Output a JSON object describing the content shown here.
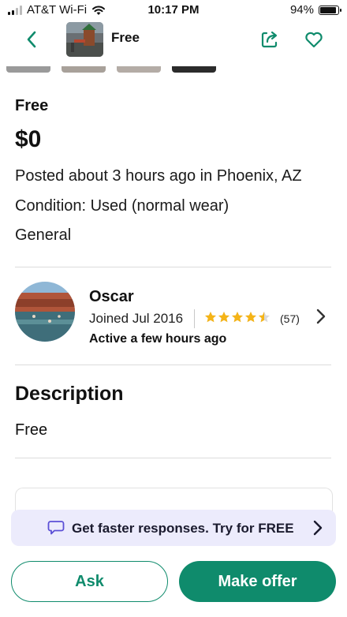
{
  "status_bar": {
    "carrier": "AT&T Wi-Fi",
    "time": "10:17 PM",
    "battery": "94%",
    "battery_level": 0.94
  },
  "header": {
    "title": "Free",
    "back_icon": "chevron-left-icon",
    "share_icon": "share-icon",
    "favorite_icon": "heart-icon"
  },
  "listing": {
    "title": "Free",
    "price": "$0",
    "posted": "Posted about 3 hours ago in Phoenix, AZ",
    "condition": "Condition: Used (normal wear)",
    "category": "General"
  },
  "seller": {
    "name": "Oscar",
    "joined": "Joined Jul 2016",
    "rating": 4.5,
    "rating_count": "(57)",
    "activity": "Active a few hours ago"
  },
  "description": {
    "heading": "Description",
    "text": "Free"
  },
  "promo": {
    "text": "Get faster responses. Try for FREE"
  },
  "actions": {
    "ask_label": "Ask",
    "offer_label": "Make offer"
  },
  "colors": {
    "accent": "#0f8b6c",
    "star": "#f5b417",
    "promo_bg": "#ecebfc"
  }
}
